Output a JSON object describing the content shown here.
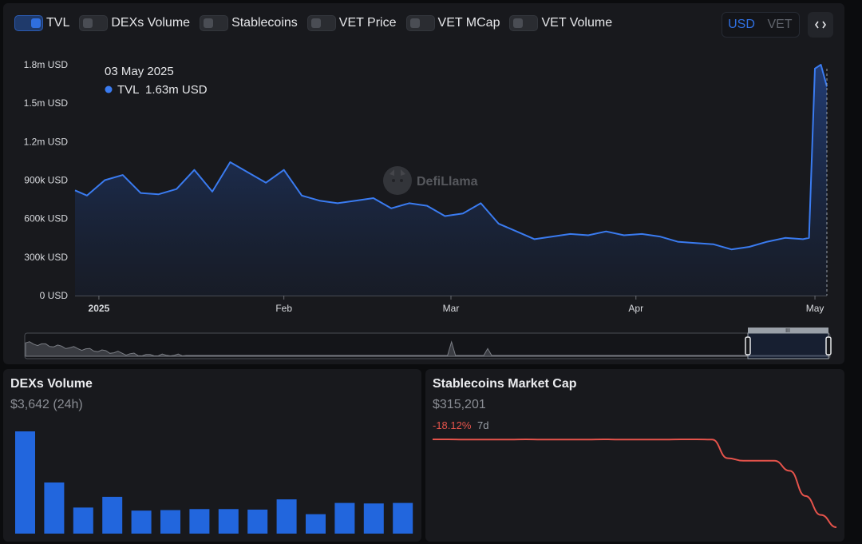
{
  "toggles": [
    {
      "label": "TVL",
      "on": true
    },
    {
      "label": "DEXs Volume",
      "on": false
    },
    {
      "label": "Stablecoins",
      "on": false
    },
    {
      "label": "VET Price",
      "on": false
    },
    {
      "label": "VET MCap",
      "on": false
    },
    {
      "label": "VET Volume",
      "on": false
    }
  ],
  "denomination": {
    "options": [
      "USD",
      "VET"
    ],
    "selected": "USD"
  },
  "embed_icon": "code-icon",
  "watermark": "DefiLlama",
  "tooltip": {
    "date": "03 May 2025",
    "series": "TVL",
    "value": "1.63m USD"
  },
  "colors": {
    "accent": "#2f6fe0",
    "tvl_line": "#3a7bf0",
    "bar": "#2266dd",
    "negative": "#e5534b"
  },
  "chart_data": [
    {
      "type": "area",
      "series": [
        {
          "name": "TVL",
          "unit": "USD"
        }
      ],
      "y_ticks": [
        "0 USD",
        "300k USD",
        "600k USD",
        "900k USD",
        "1.2m USD",
        "1.5m USD",
        "1.8m USD"
      ],
      "ylim": [
        0,
        1800000
      ],
      "x_ticks": [
        "2025",
        "Feb",
        "Mar",
        "Apr",
        "May"
      ],
      "x": [
        "2024-12-28",
        "2024-12-30",
        "2025-01-02",
        "2025-01-05",
        "2025-01-08",
        "2025-01-11",
        "2025-01-14",
        "2025-01-17",
        "2025-01-20",
        "2025-01-23",
        "2025-01-26",
        "2025-01-29",
        "2025-02-01",
        "2025-02-04",
        "2025-02-07",
        "2025-02-10",
        "2025-02-13",
        "2025-02-16",
        "2025-02-19",
        "2025-02-22",
        "2025-02-25",
        "2025-02-28",
        "2025-03-03",
        "2025-03-06",
        "2025-03-09",
        "2025-03-12",
        "2025-03-15",
        "2025-03-18",
        "2025-03-21",
        "2025-03-24",
        "2025-03-27",
        "2025-03-30",
        "2025-04-02",
        "2025-04-05",
        "2025-04-08",
        "2025-04-11",
        "2025-04-14",
        "2025-04-17",
        "2025-04-20",
        "2025-04-23",
        "2025-04-26",
        "2025-04-29",
        "2025-04-30",
        "2025-05-01",
        "2025-05-02",
        "2025-05-03"
      ],
      "values": [
        820000,
        780000,
        900000,
        940000,
        800000,
        790000,
        830000,
        980000,
        810000,
        1040000,
        960000,
        880000,
        980000,
        780000,
        740000,
        720000,
        740000,
        760000,
        680000,
        720000,
        700000,
        620000,
        640000,
        720000,
        560000,
        500000,
        440000,
        460000,
        480000,
        470000,
        500000,
        470000,
        480000,
        460000,
        420000,
        410000,
        400000,
        360000,
        380000,
        420000,
        450000,
        440000,
        450000,
        1770000,
        1800000,
        1630000
      ]
    },
    {
      "type": "bar",
      "title": "DEXs Volume",
      "headline": "$3,642 (24h)",
      "values": [
        1000,
        500,
        255,
        360,
        225,
        230,
        240,
        240,
        235,
        335,
        190,
        300,
        295,
        300
      ]
    },
    {
      "type": "line",
      "title": "Stablecoins Market Cap",
      "headline": "$315,201",
      "change": "-18.12%",
      "change_period": "7d",
      "values": [
        385000,
        385000,
        384900,
        384800,
        384800,
        384900,
        385000,
        384900,
        384800,
        384800,
        384900,
        385000,
        384900,
        384800,
        384800,
        384900,
        385000,
        385000,
        384800,
        370000,
        368000,
        368000,
        368000,
        360000,
        340000,
        325000,
        315201
      ]
    }
  ]
}
